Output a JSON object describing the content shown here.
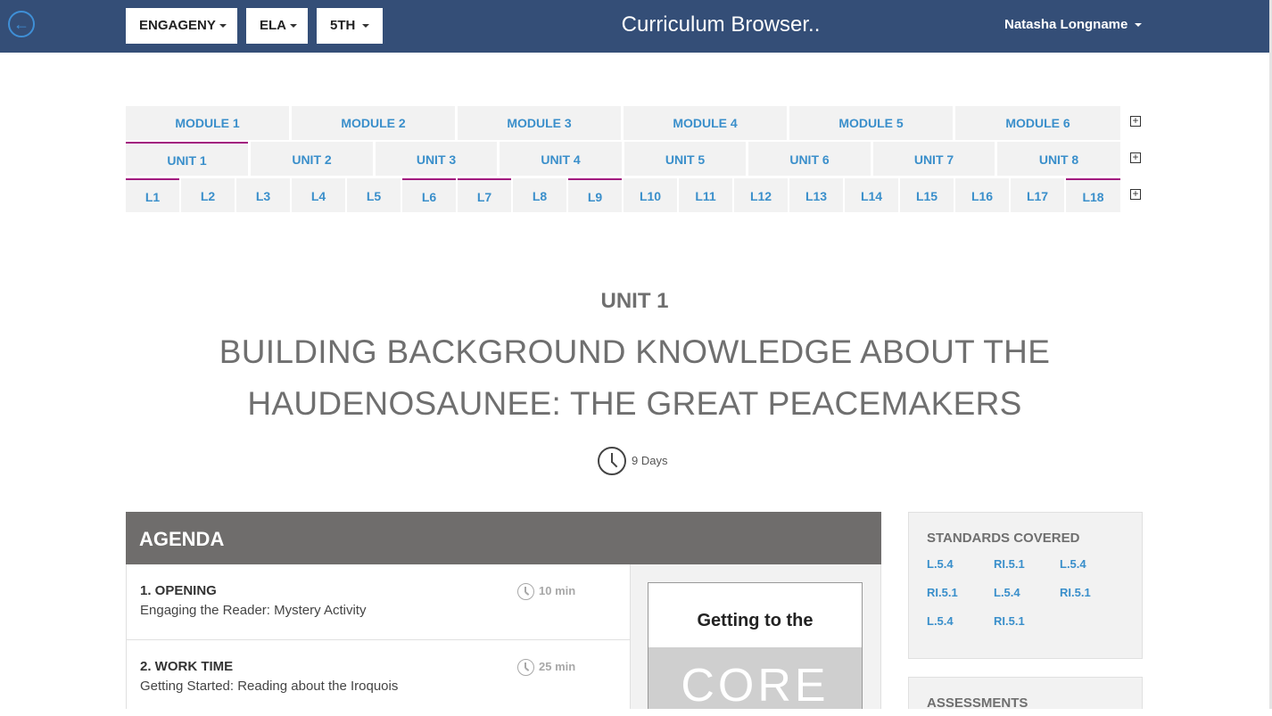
{
  "header": {
    "curriculum_selector": "ENGAGENY",
    "subject_selector": "ELA",
    "grade_selector": "5TH",
    "app_title": "Curriculum Browser..",
    "user_name": "Natasha Longname"
  },
  "nav": {
    "modules": [
      "MODULE 1",
      "MODULE 2",
      "MODULE 3",
      "MODULE 4",
      "MODULE 5",
      "MODULE 6"
    ],
    "units": [
      "UNIT 1",
      "UNIT 2",
      "UNIT 3",
      "UNIT 4",
      "UNIT 5",
      "UNIT 6",
      "UNIT 7",
      "UNIT 8"
    ],
    "lessons": [
      "L1",
      "L2",
      "L3",
      "L4",
      "L5",
      "L6",
      "L7",
      "L8",
      "L9",
      "L10",
      "L11",
      "L12",
      "L13",
      "L14",
      "L15",
      "L16",
      "L17",
      "L18"
    ],
    "accent_color": "#a2177f"
  },
  "unit": {
    "label": "UNIT 1",
    "title": "BUILDING BACKGROUND KNOWLEDGE ABOUT THE HAUDENOSAUNEE: THE GREAT PEACEMAKERS",
    "duration": "9 Days"
  },
  "agenda": {
    "heading": "AGENDA",
    "items": [
      {
        "title": "1. OPENING",
        "description": "Engaging the Reader: Mystery Activity",
        "time": "10 min"
      },
      {
        "title": "2. WORK TIME",
        "description": "Getting Started: Reading about the Iroquois",
        "time": "25 min"
      }
    ],
    "resource": {
      "top_text": "Getting to the",
      "bottom_text": "CORE"
    }
  },
  "standards": {
    "heading": "STANDARDS COVERED",
    "items": [
      "L.5.4",
      "RI.5.1",
      "L.5.4",
      "RI.5.1",
      "L.5.4",
      "RI.5.1",
      "L.5.4",
      "RI.5.1"
    ]
  },
  "assessments": {
    "heading": "ASSESSMENTS"
  },
  "colors": {
    "topbar": "#344e77",
    "link_blue": "#3a8fcb",
    "agenda_header": "#6f6d6c"
  }
}
